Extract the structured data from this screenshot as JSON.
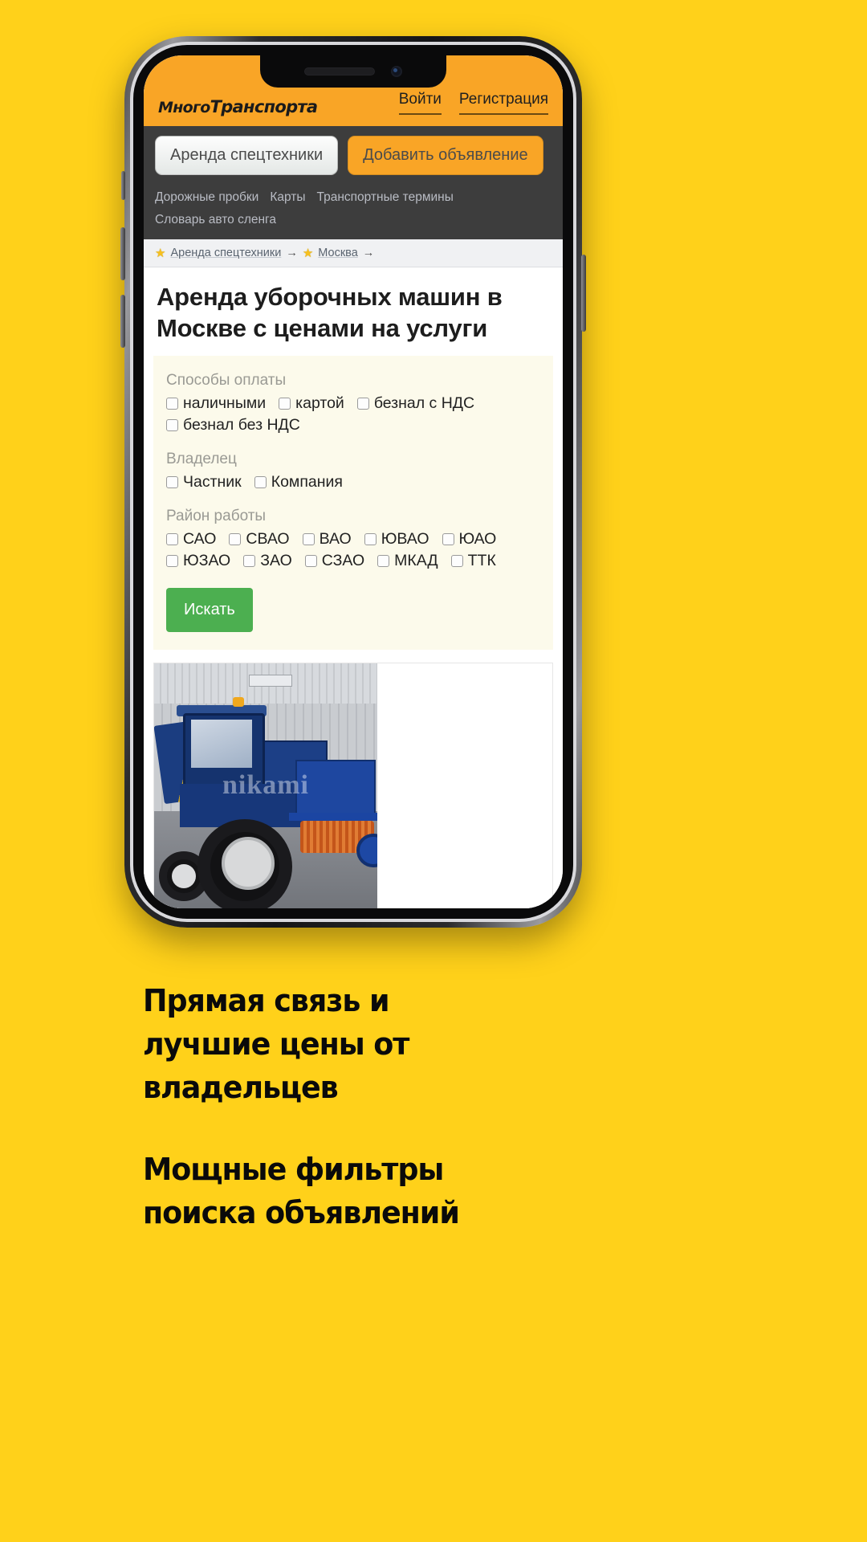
{
  "page": {
    "background_color": "#FFD11A"
  },
  "phone": {
    "status_icons": {
      "speaker": "speaker-grille",
      "camera": "front-camera"
    }
  },
  "site": {
    "header": {
      "logo_part1": "Много",
      "logo_part2": "Транспорта",
      "links": [
        {
          "label": "Войти",
          "name": "login-link"
        },
        {
          "label": "Регистрация",
          "name": "register-link"
        }
      ]
    },
    "nav": {
      "buttons": [
        {
          "label": "Аренда спецтехники",
          "style": "light"
        },
        {
          "label": "Добавить объявление",
          "style": "orange"
        }
      ],
      "links": [
        "Дорожные пробки",
        "Карты",
        "Транспортные термины",
        "Словарь авто сленга"
      ]
    },
    "breadcrumb": {
      "star_icon": "star-icon",
      "arrow_icon": "arrow-right-icon",
      "items": [
        {
          "label": "Аренда спецтехники"
        },
        {
          "label": "Москва"
        }
      ]
    },
    "title": "Аренда уборочных машин в Москве с ценами на услуги",
    "filters": {
      "groups": [
        {
          "label": "Способы оплаты",
          "options": [
            "наличными",
            "картой",
            "безнал с НДС",
            "безнал без НДС"
          ]
        },
        {
          "label": "Владелец",
          "options": [
            "Частник",
            "Компания"
          ]
        },
        {
          "label": "Район работы",
          "options": [
            "САО",
            "СВАО",
            "ВАО",
            "ЮВАО",
            "ЮАО",
            "ЮЗАО",
            "ЗАО",
            "СЗАО",
            "МКАД",
            "ТТК"
          ]
        }
      ],
      "submit_label": "Искать",
      "submit_color": "#4CAF50"
    },
    "result": {
      "photo_alt": "blue-tractor-with-sweeper-brush",
      "watermark": "nikami"
    }
  },
  "promo": {
    "headlines": [
      "Прямая связь и лучшие цены от владельцев",
      "Мощные фильтры поиска объявлений"
    ]
  }
}
